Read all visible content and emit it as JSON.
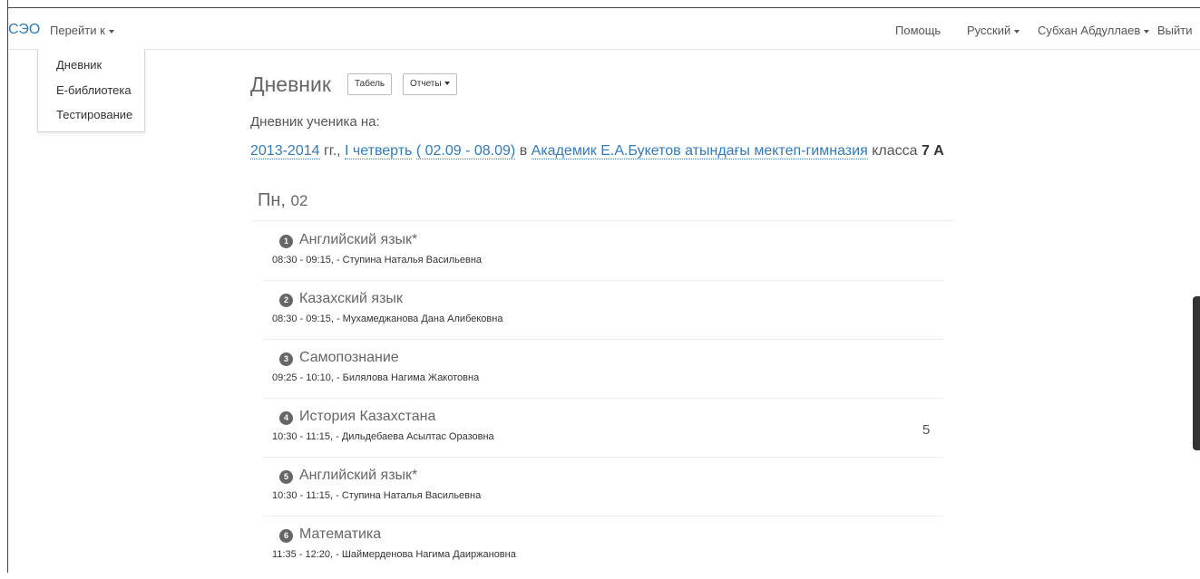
{
  "navbar": {
    "brand": "СЭО",
    "goto_label": "Перейти к",
    "help": "Помощь",
    "language": "Русский",
    "user": "Субхан Абдуллаев",
    "logout": "Выйти"
  },
  "goto_menu": {
    "items": [
      "Дневник",
      "Е-библиотека",
      "Тестирование"
    ]
  },
  "page": {
    "title": "Дневник",
    "tabel_button": "Табель",
    "reports_button": "Отчеты",
    "subtitle": "Дневник ученика на:",
    "year": "2013-2014",
    "year_suffix": "гг.,",
    "quarter": "I четверть",
    "dates": "( 02.09 - 08.09)",
    "in_word": "в",
    "school": "Академик Е.А.Букетов атындағы мектеп-гимназия",
    "class_word": "класса",
    "class_name": "7 А"
  },
  "day": {
    "weekday": "Пн,",
    "date": "02"
  },
  "lessons": [
    {
      "num": "1",
      "subject": "Английский язык*",
      "meta": "08:30 - 09:15, - Ступина Наталья Васильевна",
      "grade": ""
    },
    {
      "num": "2",
      "subject": "Казахский язык",
      "meta": "08:30 - 09:15, - Мухамеджанова Дана Алибековна",
      "grade": ""
    },
    {
      "num": "3",
      "subject": "Самопознание",
      "meta": "09:25 - 10:10, - Билялова Нагима Жакотовна",
      "grade": ""
    },
    {
      "num": "4",
      "subject": "История Казахстана",
      "meta": "10:30 - 11:15, - Дильдебаева Асылтас Оразовна",
      "grade": "5"
    },
    {
      "num": "5",
      "subject": "Английский язык*",
      "meta": "10:30 - 11:15, - Ступина Наталья Васильевна",
      "grade": ""
    },
    {
      "num": "6",
      "subject": "Математика",
      "meta": "11:35 - 12:20, - Шаймерденова Нагима Даиржановна",
      "grade": ""
    }
  ]
}
